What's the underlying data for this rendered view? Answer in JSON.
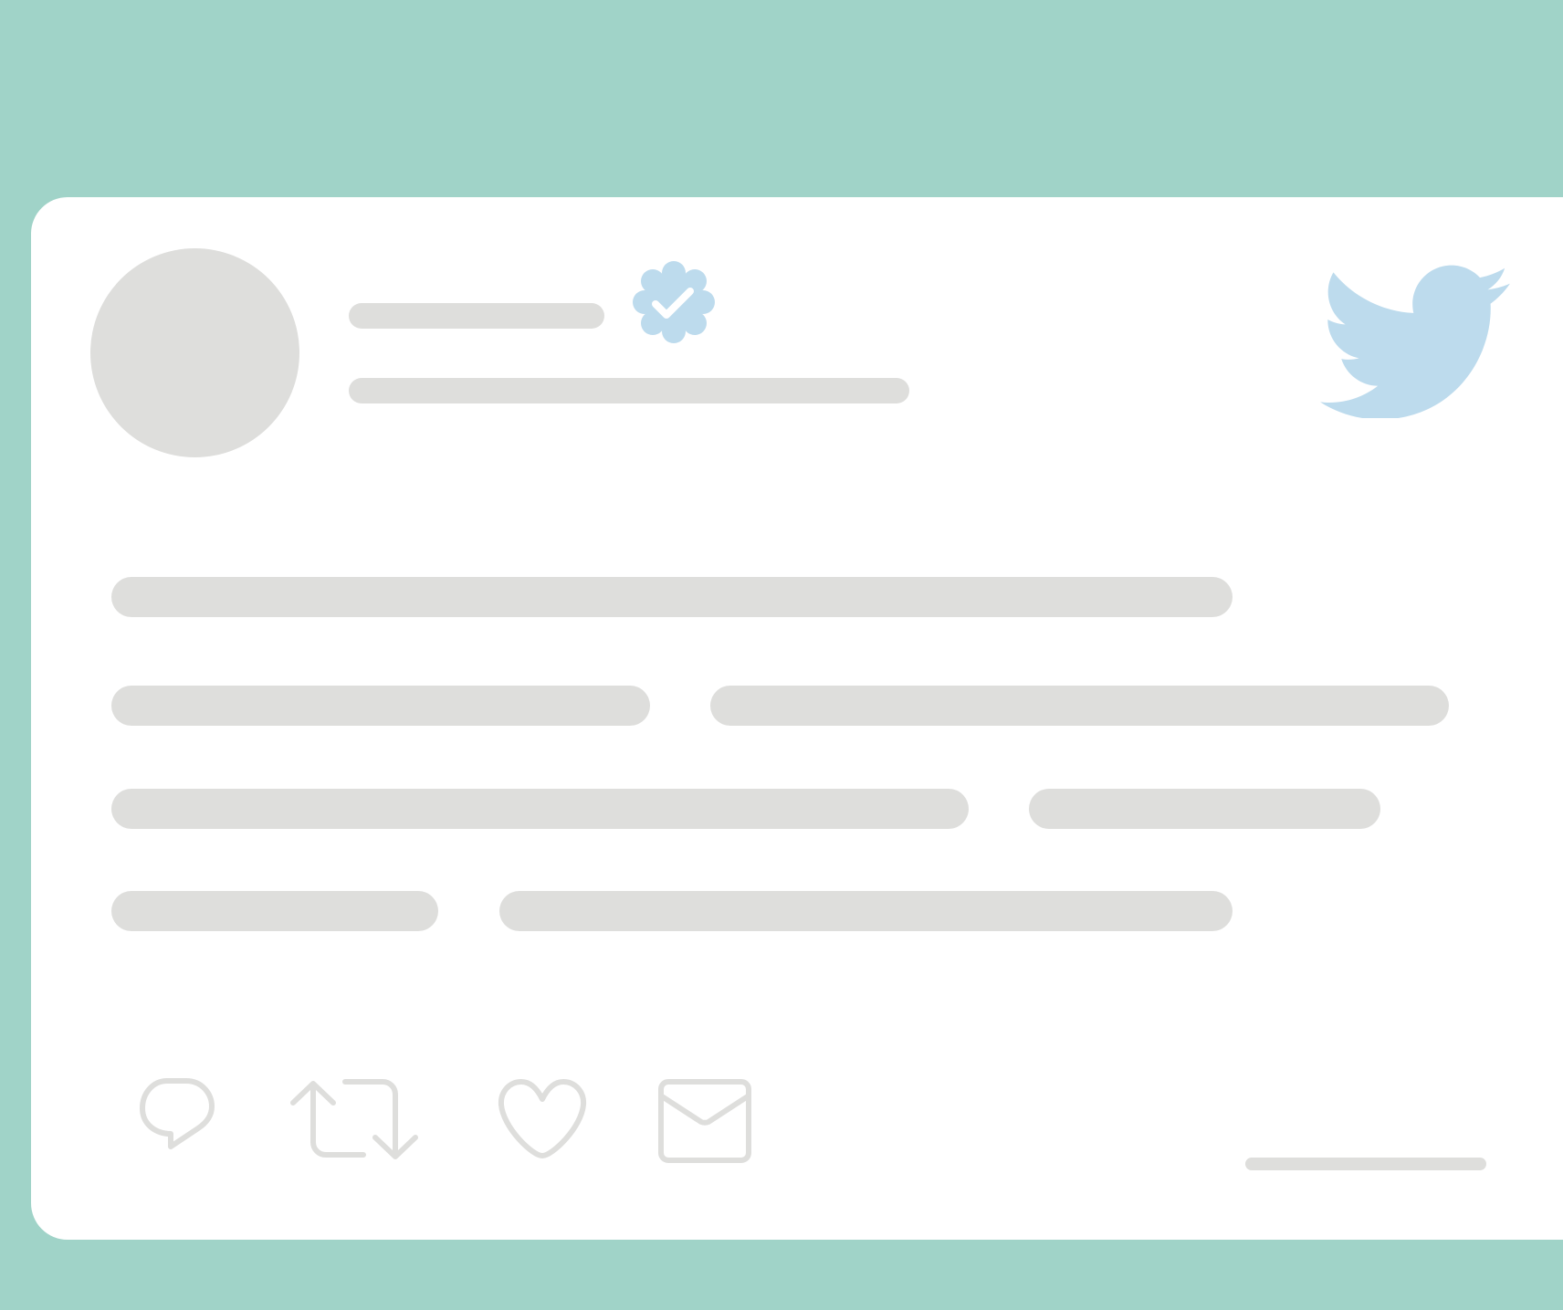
{
  "colors": {
    "background": "#a0d3c8",
    "card": "#ffffff",
    "placeholder": "#dededc",
    "accent": "#bddbed"
  },
  "header": {
    "avatar": "avatar-placeholder",
    "verified_icon": "verified-badge-icon",
    "brand_icon": "twitter-bird-icon"
  },
  "actions": [
    {
      "icon": "reply-icon"
    },
    {
      "icon": "retweet-icon"
    },
    {
      "icon": "like-icon"
    },
    {
      "icon": "message-icon"
    }
  ]
}
